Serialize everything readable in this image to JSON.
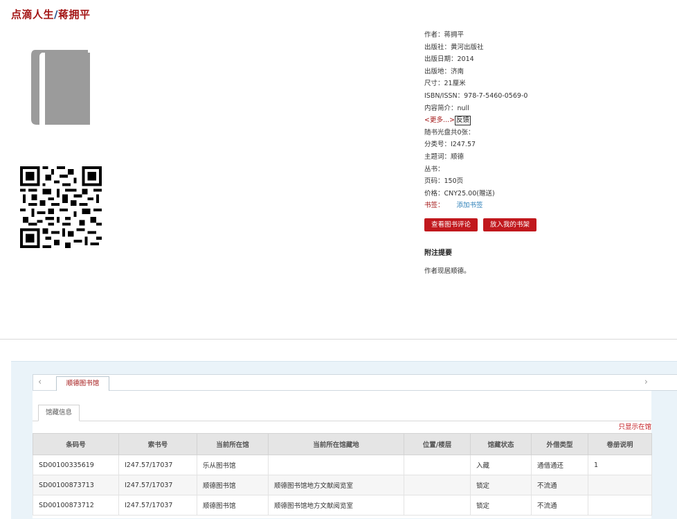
{
  "book": {
    "title_main": "点滴人生",
    "title_sep": "/",
    "title_author": "蒋拥平"
  },
  "meta": {
    "author": "作者：蒋拥平",
    "publisher": "出版社：黄河出版社",
    "pub_date": "出版日期：2014",
    "pub_place": "出版地：济南",
    "size": "尺寸：21厘米",
    "isbn": "ISBN/ISSN：978-7-5460-0569-0",
    "summary": "内容简介：null",
    "more_link": "<更多...>",
    "feedback": "反馈",
    "disc": "随书光盘共0张：",
    "class_no": "分类号：I247.57",
    "subject": "主题词：顺德",
    "series": "丛书：",
    "pages": "页码：150页",
    "price": "价格：CNY25.00(赠送)",
    "tag_label": "书签：",
    "tag_add": "添加书签"
  },
  "actions": {
    "view_reviews": "查看图书评论",
    "add_shelf": "放入我的书架"
  },
  "note": {
    "title": "附注提要",
    "text": "作者现居顺德。"
  },
  "tabs": {
    "nav_left": "‹",
    "nav_right": "›",
    "library": "顺德图书馆",
    "holdings": "馆藏信息",
    "only_show": "只显示在馆"
  },
  "table": {
    "headers": [
      "条码号",
      "索书号",
      "当前所在馆",
      "当前所在馆藏地",
      "位置/楼层",
      "馆藏状态",
      "外借类型",
      "卷册说明"
    ],
    "rows": [
      [
        "SD00100335619",
        "I247.57/17037",
        "乐从图书馆",
        "",
        "",
        "入藏",
        "通借通还",
        "1"
      ],
      [
        "SD00100873713",
        "I247.57/17037",
        "顺德图书馆",
        "顺德图书馆地方文献阅览室",
        "",
        "锁定",
        "不流通",
        ""
      ],
      [
        "SD00100873712",
        "I247.57/17037",
        "顺德图书馆",
        "顺德图书馆地方文献阅览室",
        "",
        "锁定",
        "不流通",
        ""
      ]
    ]
  },
  "colors": {
    "accent_red": "#c1181d",
    "title_red": "#a31515",
    "link_blue": "#2c7fb8"
  }
}
